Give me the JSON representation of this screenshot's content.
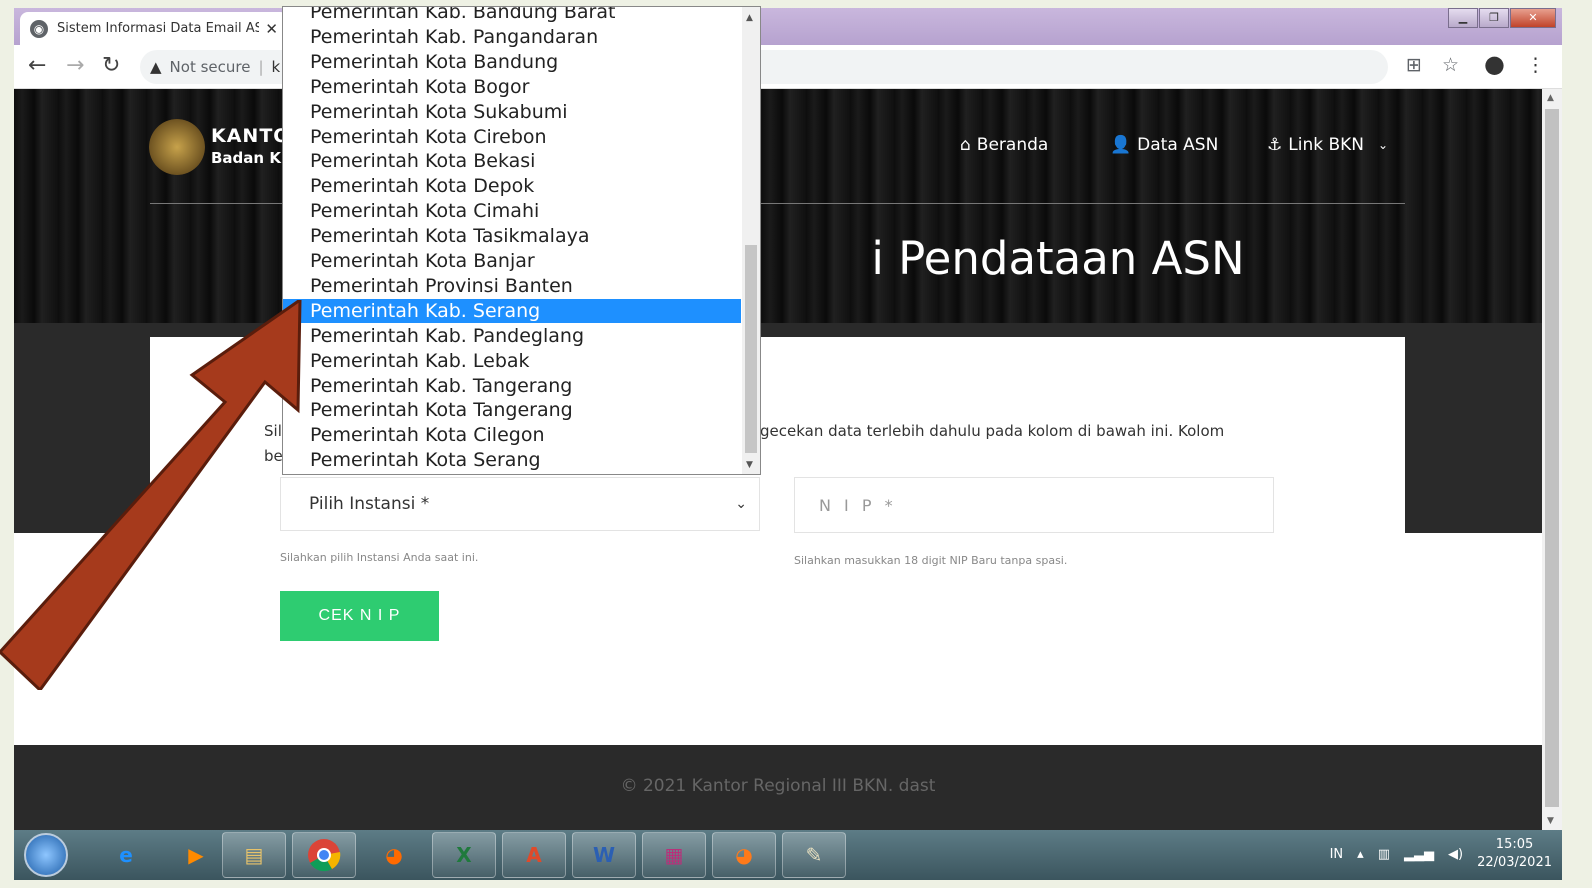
{
  "browser": {
    "tab_title": "Sistem Informasi Data Email ASN",
    "tab_close": "✕",
    "security_label": "Not secure",
    "url": "k"
  },
  "site": {
    "brand_line1": "KANTO",
    "brand_line2": "Badan K",
    "nav": [
      {
        "icon": "⌂",
        "label": "Beranda"
      },
      {
        "icon": "👤",
        "label": "Data ASN"
      },
      {
        "icon": "⚓",
        "label": "Link BKN"
      }
    ],
    "hero_title": "i Pendataan ASN",
    "intro_left": "Sil",
    "intro_left2": "be",
    "intro_right": "gecekan data terlebih dahulu pada kolom di bawah ini. Kolom",
    "select_placeholder": "Pilih Instansi *",
    "select_hint": "Silahkan pilih Instansi Anda saat ini.",
    "nip_placeholder": "N I P *",
    "nip_hint": "Silahkan masukkan 18 digit NIP Baru tanpa spasi.",
    "check_button": "CEK N I P",
    "footer": "© 2021 Kantor Regional III BKN. dast"
  },
  "dropdown": {
    "items": [
      "Pemerintah Kab. Bandung Barat",
      "Pemerintah Kab. Pangandaran",
      "Pemerintah Kota Bandung",
      "Pemerintah Kota Bogor",
      "Pemerintah Kota Sukabumi",
      "Pemerintah Kota Cirebon",
      "Pemerintah Kota Bekasi",
      "Pemerintah Kota Depok",
      "Pemerintah Kota Cimahi",
      "Pemerintah Kota Tasikmalaya",
      "Pemerintah Kota Banjar",
      "Pemerintah Provinsi Banten",
      "Pemerintah Kab. Serang",
      "Pemerintah Kab. Pandeglang",
      "Pemerintah Kab. Lebak",
      "Pemerintah Kab. Tangerang",
      "Pemerintah Kota Tangerang",
      "Pemerintah Kota Cilegon",
      "Pemerintah Kota Serang"
    ],
    "selected": "Pemerintah Kab. Serang"
  },
  "taskbar": {
    "language": "IN",
    "time": "15:05",
    "date": "22/03/2021"
  },
  "colors": {
    "selection": "#1e90ff",
    "button": "#2ecc71",
    "arrow": "#a63a1c"
  }
}
